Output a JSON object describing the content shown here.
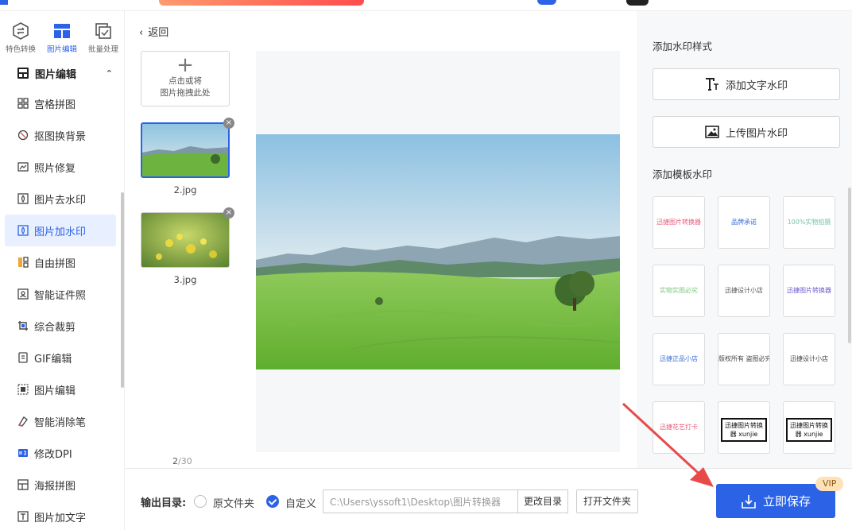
{
  "sidebar": {
    "tabs": [
      {
        "label": "特色转换",
        "icon": "exchange-icon"
      },
      {
        "label": "图片编辑",
        "icon": "image-edit-icon"
      },
      {
        "label": "批量处理",
        "icon": "batch-icon"
      }
    ],
    "section": {
      "label": "图片编辑",
      "expanded": true
    },
    "items": [
      {
        "label": "宫格拼图",
        "icon": "grid-icon"
      },
      {
        "label": "抠图换背景",
        "icon": "cutout-icon"
      },
      {
        "label": "照片修复",
        "icon": "photo-icon"
      },
      {
        "label": "图片去水印",
        "icon": "remove-watermark-icon"
      },
      {
        "label": "图片加水印",
        "icon": "add-watermark-icon"
      },
      {
        "label": "自由拼图",
        "icon": "collage-icon"
      },
      {
        "label": "智能证件照",
        "icon": "id-photo-icon"
      },
      {
        "label": "综合裁剪",
        "icon": "crop-icon"
      },
      {
        "label": "GIF编辑",
        "icon": "gif-icon"
      },
      {
        "label": "图片编辑",
        "icon": "edit-icon"
      },
      {
        "label": "智能消除笔",
        "icon": "eraser-icon"
      },
      {
        "label": "修改DPI",
        "icon": "dpi-icon"
      },
      {
        "label": "海报拼图",
        "icon": "poster-icon"
      },
      {
        "label": "图片加文字",
        "icon": "text-icon"
      }
    ],
    "active_index": 4
  },
  "file_panel": {
    "back_label": "返回",
    "add_line1": "点击或将",
    "add_line2": "图片拖拽此处",
    "files": [
      {
        "name": "2.jpg",
        "selected": true
      },
      {
        "name": "3.jpg",
        "selected": false
      }
    ],
    "counter_current": "2",
    "counter_total": "/30"
  },
  "right_panel": {
    "style_title": "添加水印样式",
    "text_watermark_label": "添加文字水印",
    "image_watermark_label": "上传图片水印",
    "template_title": "添加模板水印",
    "templates": [
      {
        "text": "迅捷图片转换器",
        "color": "#e85a7a"
      },
      {
        "text": "品牌承诺",
        "color": "#3a6fd8"
      },
      {
        "text": "100%实物拍摄",
        "color": "#7bc4a8"
      },
      {
        "text": "实物实图必究",
        "color": "#7ec67e"
      },
      {
        "text": "迅捷设计小店",
        "color": "#555555"
      },
      {
        "text": "迅捷图片转换器",
        "color": "#6a5acd"
      },
      {
        "text": "迅捷正品小店",
        "color": "#3a6fd8"
      },
      {
        "text": "版权所有 盗图必究",
        "color": "#444444"
      },
      {
        "text": "迅捷设计小店",
        "color": "#444444"
      },
      {
        "text": "迅捷花艺打卡",
        "color": "#e85a7a"
      },
      {
        "text": "迅捷图片转换器 xunjie",
        "color": "#111111"
      },
      {
        "text": "迅捷图片转换器 xunjie",
        "color": "#111111"
      }
    ]
  },
  "bottom_bar": {
    "output_label": "输出目录:",
    "radio_original": "原文件夹",
    "radio_custom": "自定义",
    "path_value": "C:\\Users\\yssoft1\\Desktop\\图片转换器",
    "change_dir_label": "更改目录",
    "open_folder_label": "打开文件夹",
    "save_label": "立即保存",
    "vip_badge": "VIP"
  },
  "colors": {
    "accent": "#2c63e6",
    "annotation_arrow": "#e84a4a"
  }
}
